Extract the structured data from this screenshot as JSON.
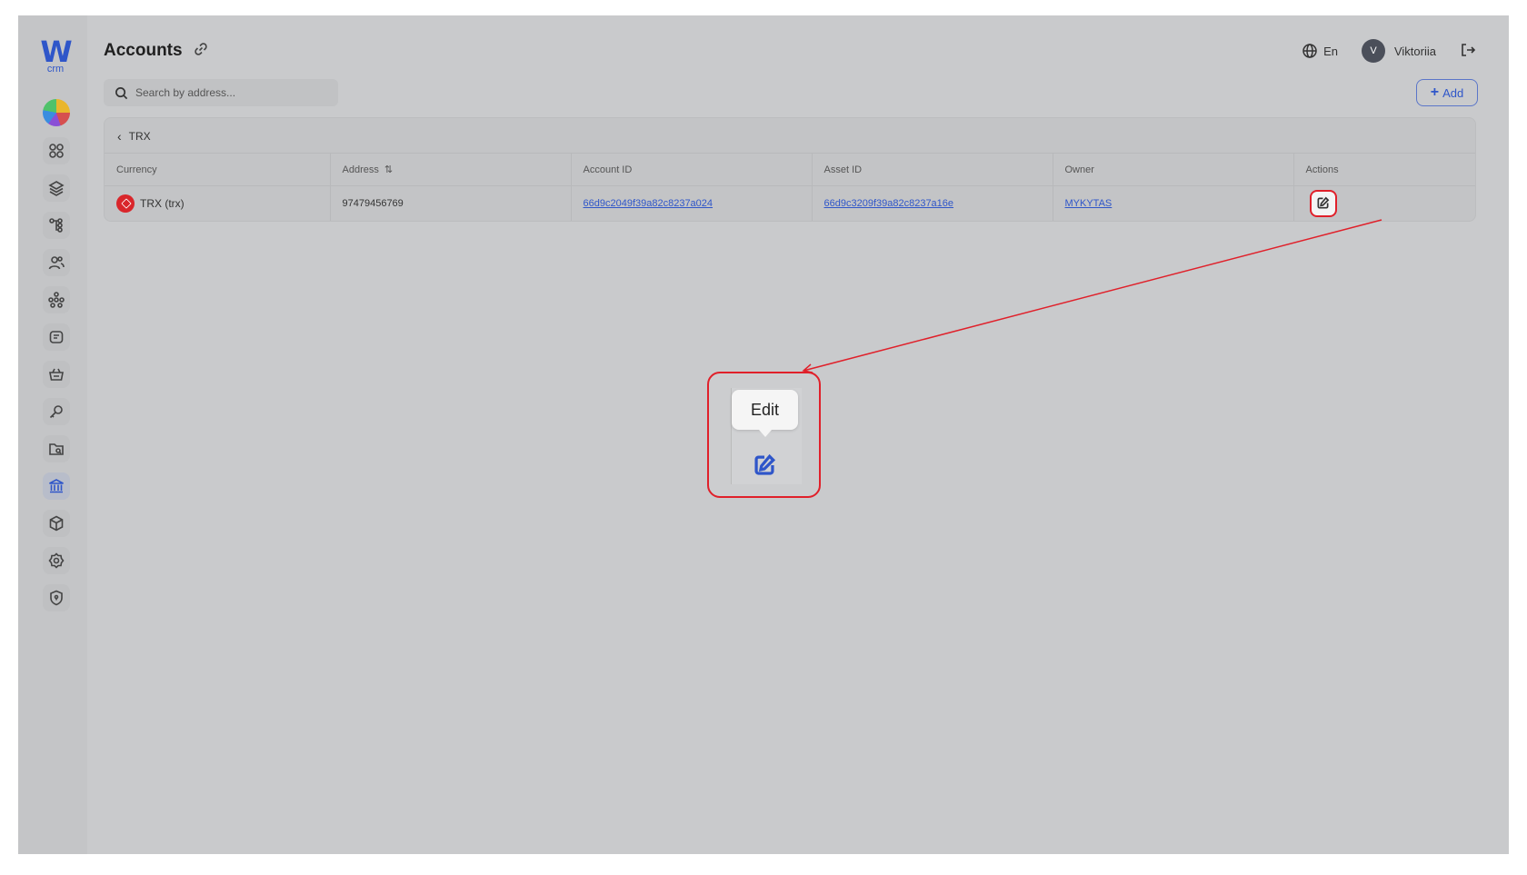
{
  "logo": {
    "letter": "W",
    "sub": "crm"
  },
  "header": {
    "title": "Accounts",
    "language": "En",
    "user_initial": "V",
    "user_name": "Viktoriia"
  },
  "search": {
    "placeholder": "Search by address..."
  },
  "toolbar": {
    "add_label": "Add"
  },
  "table": {
    "back_label": "TRX",
    "columns": [
      "Currency",
      "Address",
      "Account ID",
      "Asset ID",
      "Owner",
      "Actions"
    ],
    "rows": [
      {
        "currency": "TRX (trx)",
        "address": "97479456769",
        "account_id": "66d9c2049f39a82c8237a024",
        "asset_id": "66d9c3209f39a82c8237a16e",
        "owner": "MYKYTAS"
      }
    ]
  },
  "tooltip": {
    "label": "Edit"
  },
  "colors": {
    "accent": "#2f56c9",
    "highlight": "#e0202a",
    "trx_red": "#d9262b"
  },
  "sidebar_icons": [
    "dashboard-icon",
    "layers-icon",
    "hierarchy-icon",
    "users-icon",
    "network-icon",
    "tickets-icon",
    "basket-icon",
    "key-icon",
    "folder-search-icon",
    "bank-icon",
    "box-icon",
    "settings-icon",
    "shield-icon"
  ]
}
